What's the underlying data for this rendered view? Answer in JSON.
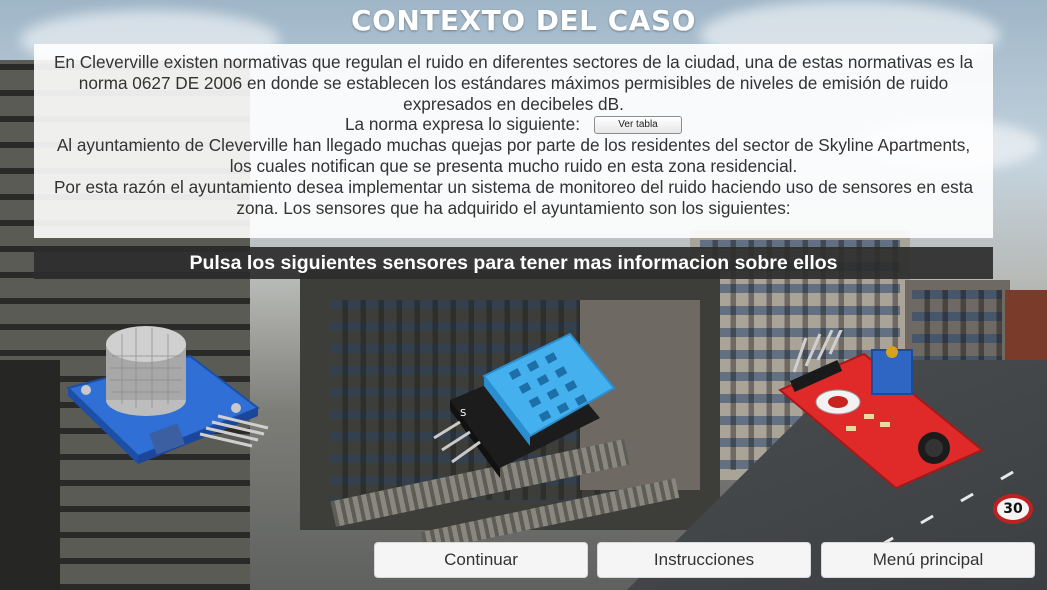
{
  "title": "CONTEXTO DEL CASO",
  "panel": {
    "paragraph1": "En Cleverville existen normativas que regulan el ruido en diferentes sectores de la ciudad, una de estas normativas es la norma 0627 DE 2006 en donde se establecen los estándares máximos permisibles de niveles de emisión de ruido expresados en decibeles dB.",
    "norma_label": "La norma expresa lo siguiente:",
    "ver_tabla_button": "Ver tabla",
    "paragraph2": "Al ayuntamiento de Cleverville han llegado muchas quejas por parte de los residentes del sector de Skyline Apartments, los cuales notifican que se presenta mucho ruido en esta zona residencial.",
    "paragraph3": "Por esta razón el ayuntamiento desea implementar un sistema de monitoreo del ruido haciendo uso de sensores en esta zona.  Los sensores que ha adquirido el ayuntamiento son los siguientes:"
  },
  "prompt": "Pulsa los siguientes sensores para tener mas informacion sobre ellos",
  "sensors": [
    {
      "icon": "gas-sensor-icon",
      "color": "#2f6fd6"
    },
    {
      "icon": "temperature-humidity-sensor-icon",
      "color": "#3aa3e8"
    },
    {
      "icon": "sound-sensor-icon",
      "color": "#e02a2a"
    }
  ],
  "scene": {
    "speed_sign": "30"
  },
  "buttons": {
    "continuar": "Continuar",
    "instrucciones": "Instrucciones",
    "menu_principal": "Menú principal"
  },
  "colors": {
    "panel_bg": "#ffffff",
    "prompt_bg": "#2d2d2d",
    "title": "#ffffff"
  }
}
